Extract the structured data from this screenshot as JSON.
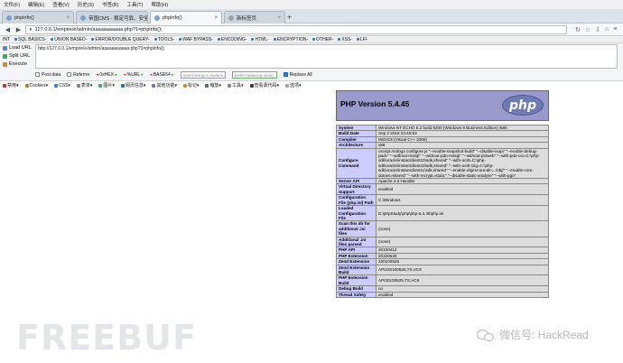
{
  "menubar": [
    "文件(F)",
    "编辑(E)",
    "查看(V)",
    "历史(S)",
    "书签(B)",
    "工具(T)",
    "帮助(H)"
  ],
  "tabs": [
    {
      "label": "phpinfo()",
      "active": false
    },
    {
      "label": "帝国CMS - 稳定可靠、安全...",
      "active": false
    },
    {
      "label": "phpinfo()",
      "active": true
    },
    {
      "label": "新标签页",
      "active": false
    }
  ],
  "url": "127.0.0.1/empire/e/admin/aaaaaaaaaaa.php?1=phpinfo();",
  "hackbar": {
    "menu": [
      "INT",
      "SQL BASICS-",
      "UNION BASED-",
      "ERROR/DOUBLE QUERY-",
      "TOOLS-",
      "WAF BYPASS-",
      "ENCODING-",
      "HTML-",
      "ENCRYPTION-",
      "OTHER-",
      "XSS-",
      "LFI-"
    ],
    "actions": [
      "Load URL",
      "Split URL",
      "Execute"
    ],
    "textarea": "http://127.0.0.1/empire/e/admin/aaaaaaaaaaa.php?1=phpinfo();",
    "options": [
      "Post data",
      "Referrer",
      "0xHEX",
      "%URL",
      "BASE64"
    ],
    "replace_placeholder": "Insert string to replace",
    "replacing_placeholder": "Insert replacing string",
    "replace_all": "Replace All"
  },
  "toolbar2": [
    "禁用▾",
    "Cookies▾",
    "CSS▾",
    "表单▾",
    "图片▾",
    "网页信息▾",
    "其他功能▾",
    "标记▾",
    "缩放▾",
    "工具▾",
    "查看源代码▾",
    "选项▾"
  ],
  "php": {
    "version": "PHP Version 5.4.45",
    "logo": "php",
    "rows": [
      {
        "k": "System",
        "v": "Windows NT ECHO 6.2 build 9200 (Windows 8 Business Edition) i586"
      },
      {
        "k": "Build Date",
        "v": "Sep 2 2015 23:45:53"
      },
      {
        "k": "Compiler",
        "v": "MSVC9 (Visual C++ 2008)"
      },
      {
        "k": "Architecture",
        "v": "x86"
      },
      {
        "k": "Configure Command",
        "v": "cscript /nologo configure.js \"--enable-snapshot-build\" \"--disable-isapi\" \"--enable-debug-pack\" \"--without-mssql\" \"--without-pdo-mssql\" \"--without-pi3web\" \"--with-pdo-oci=C:\\php-sdk\\oracle\\instantclient10\\sdk,shared\" \"--with-oci8=C:\\php-sdk\\oracle\\instantclient10\\sdk,shared\" \"--with-oci8-11g=C:\\php-sdk\\oracle\\instantclient11\\sdk,shared\" \"--enable-object-out-dir=../obj/\" \"--enable-com-dotnet=shared\" \"--with-mcrypt=static\" \"--disable-static-analyze\" \"--with-pgo\""
      },
      {
        "k": "Server API",
        "v": "Apache 2.0 Handler"
      },
      {
        "k": "Virtual Directory Support",
        "v": "enabled"
      },
      {
        "k": "Configuration File (php.ini) Path",
        "v": "C:\\Windows"
      },
      {
        "k": "Loaded Configuration File",
        "v": "D:\\phpStudy\\php\\php-5.4.45\\php.ini"
      },
      {
        "k": "Scan this dir for additional .ini files",
        "v": "(none)"
      },
      {
        "k": "Additional .ini files parsed",
        "v": "(none)"
      },
      {
        "k": "PHP API",
        "v": "20100412"
      },
      {
        "k": "PHP Extension",
        "v": "20100525"
      },
      {
        "k": "Zend Extension",
        "v": "220100525"
      },
      {
        "k": "Zend Extension Build",
        "v": "API220100525,TS,VC9"
      },
      {
        "k": "PHP Extension Build",
        "v": "API20100525,TS,VC9"
      },
      {
        "k": "Debug Build",
        "v": "no"
      },
      {
        "k": "Thread Safety",
        "v": "enabled"
      }
    ]
  },
  "watermarks": {
    "freebuf": "FREEBUF",
    "hackread": "微信号: HackRead"
  },
  "colors": {
    "php_header": "#9999cc",
    "php_key": "#ccccff",
    "php_value": "#dddddd"
  }
}
